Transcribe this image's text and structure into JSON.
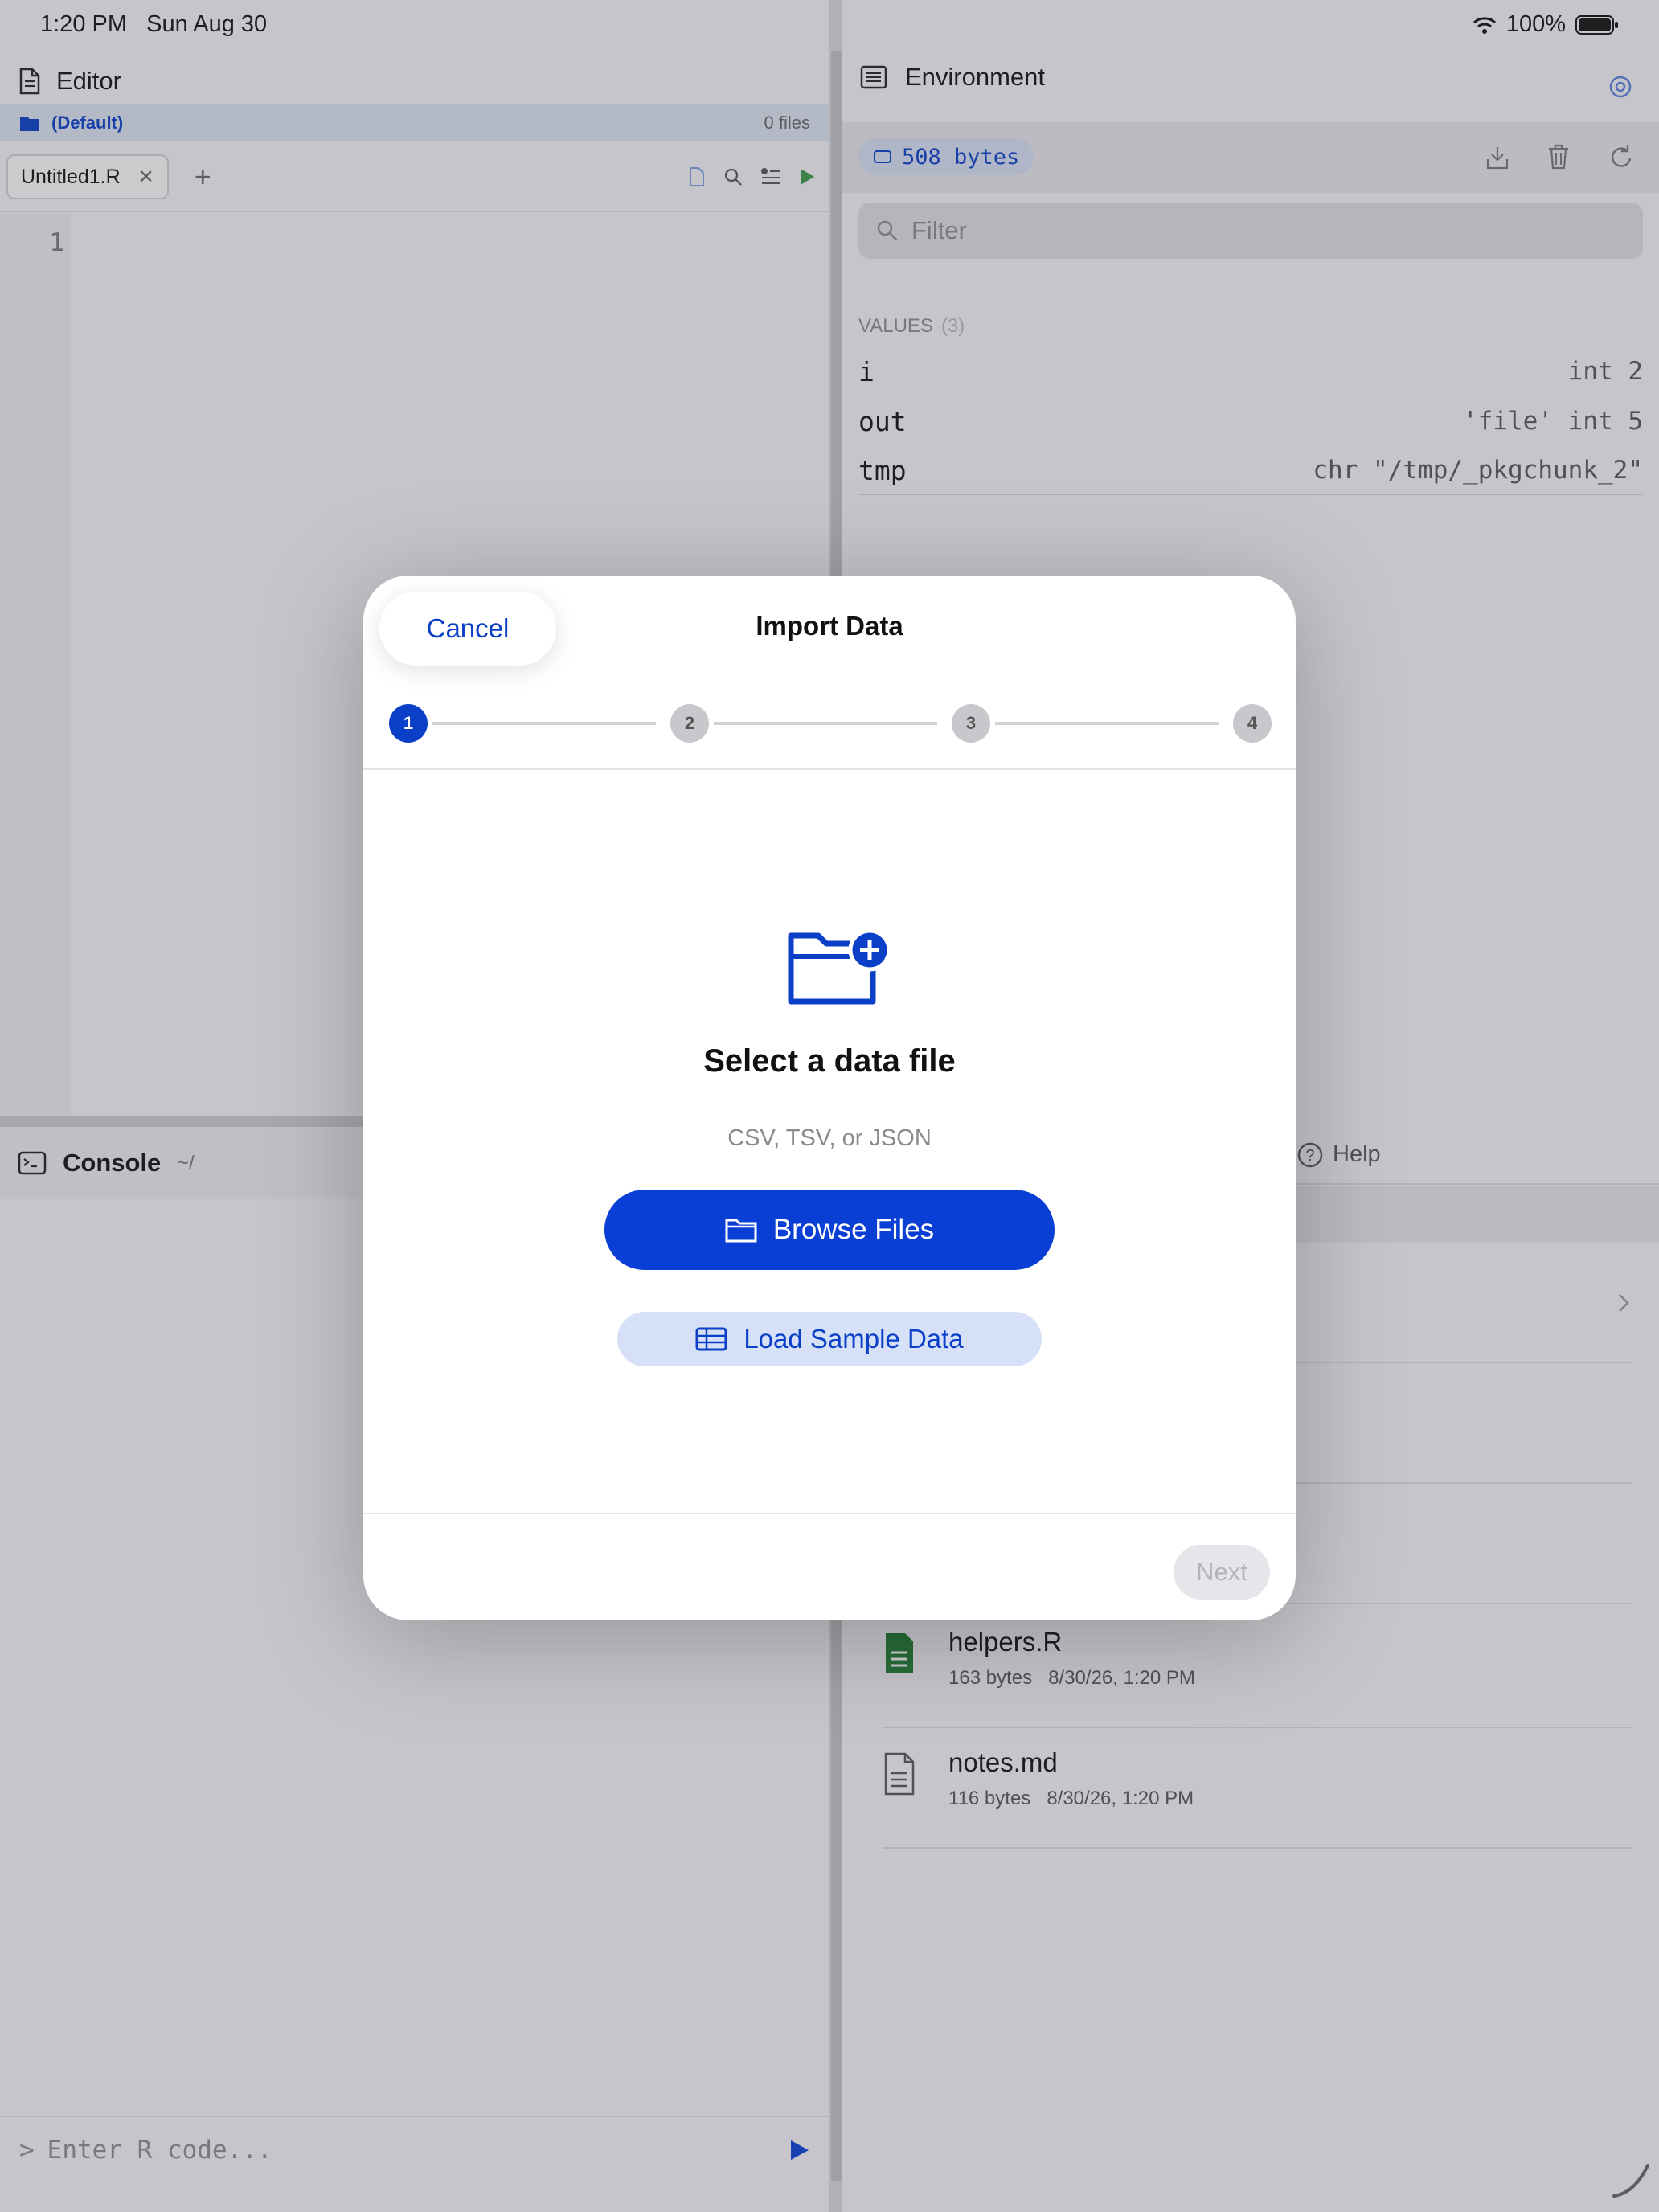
{
  "status_bar": {
    "time": "1:20 PM",
    "date": "Sun Aug 30",
    "battery": "100%"
  },
  "editor": {
    "title": "Editor",
    "project": "(Default)",
    "file_count": "0 files",
    "tab_label": "Untitled1.R",
    "line_number": "1"
  },
  "console": {
    "title": "Console",
    "path": "~/",
    "placeholder": "Enter R code...",
    "prompt": ">"
  },
  "environment": {
    "title": "Environment",
    "memory": "508 bytes",
    "filter_placeholder": "Filter",
    "values_heading": "VALUES",
    "values_count": "(3)",
    "values": [
      {
        "name": "i",
        "value": "int 2"
      },
      {
        "name": "out",
        "value": "'file' int 5"
      },
      {
        "name": "tmp",
        "value": "chr \"/tmp/_pkgchunk_2\""
      }
    ]
  },
  "files_panel": {
    "help_tab": "Help",
    "files": [
      {
        "name": "helpers.R",
        "size": "163 bytes",
        "date": "8/30/26, 1:20 PM"
      },
      {
        "name": "notes.md",
        "size": "116 bytes",
        "date": "8/30/26, 1:20 PM"
      }
    ]
  },
  "modal": {
    "cancel_label": "Cancel",
    "title": "Import Data",
    "steps": [
      "1",
      "2",
      "3",
      "4"
    ],
    "active_step": 1,
    "heading": "Select a data file",
    "subtitle": "CSV, TSV, or JSON",
    "browse_label": "Browse Files",
    "sample_label": "Load Sample Data",
    "next_label": "Next"
  },
  "colors": {
    "accent": "#0a3fd6",
    "accent_light": "#d6e1f8",
    "disabled": "#b5b5b8"
  }
}
